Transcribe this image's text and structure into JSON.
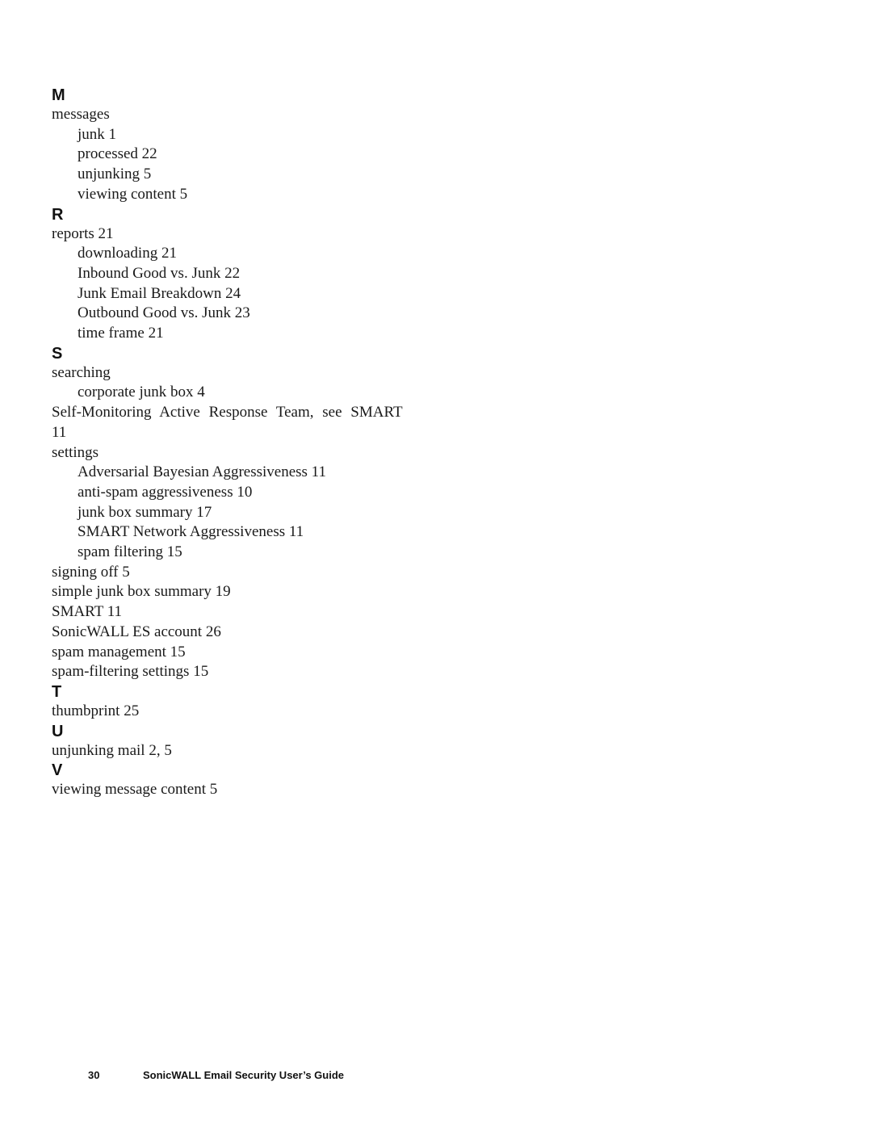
{
  "index": {
    "sections": [
      {
        "letter": "M",
        "entries": [
          {
            "text": "messages",
            "level": 0
          },
          {
            "text": "junk 1",
            "level": 1
          },
          {
            "text": "processed 22",
            "level": 1
          },
          {
            "text": "unjunking 5",
            "level": 1
          },
          {
            "text": "viewing content 5",
            "level": 1
          }
        ]
      },
      {
        "letter": "R",
        "entries": [
          {
            "text": "reports 21",
            "level": 0
          },
          {
            "text": "downloading 21",
            "level": 1
          },
          {
            "text": "Inbound Good vs. Junk 22",
            "level": 1
          },
          {
            "text": "Junk Email Breakdown 24",
            "level": 1
          },
          {
            "text": "Outbound Good vs. Junk 23",
            "level": 1
          },
          {
            "text": "time frame 21",
            "level": 1
          }
        ]
      },
      {
        "letter": "S",
        "entries": [
          {
            "text": "searching",
            "level": 0
          },
          {
            "text": "corporate junk box 4",
            "level": 1
          },
          {
            "text": "Self-Monitoring Active Response Team, see SMART 11",
            "level": 0
          },
          {
            "text": "settings",
            "level": 0
          },
          {
            "text": "Adversarial Bayesian Aggressiveness 11",
            "level": 1
          },
          {
            "text": "anti-spam aggressiveness 10",
            "level": 1
          },
          {
            "text": "junk box summary 17",
            "level": 1
          },
          {
            "text": "SMART Network Aggressiveness 11",
            "level": 1
          },
          {
            "text": "spam filtering 15",
            "level": 1
          },
          {
            "text": "signing off 5",
            "level": 0
          },
          {
            "text": "simple junk box summary 19",
            "level": 0
          },
          {
            "text": "SMART 11",
            "level": 0
          },
          {
            "text": "SonicWALL ES account 26",
            "level": 0
          },
          {
            "text": "spam management 15",
            "level": 0
          },
          {
            "text": "spam-filtering settings 15",
            "level": 0
          }
        ]
      },
      {
        "letter": "T",
        "entries": [
          {
            "text": "thumbprint 25",
            "level": 0
          }
        ]
      },
      {
        "letter": "U",
        "entries": [
          {
            "text": "unjunking mail 2, 5",
            "level": 0
          }
        ]
      },
      {
        "letter": "V",
        "entries": [
          {
            "text": "viewing message content 5",
            "level": 0
          }
        ]
      }
    ]
  },
  "footer": {
    "page_number": "30",
    "title": "SonicWALL Email Security User’s Guide"
  }
}
